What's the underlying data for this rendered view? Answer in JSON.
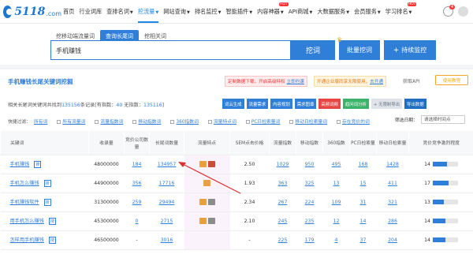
{
  "nav": {
    "logo_text": "5118",
    "logo_suffix": ".com",
    "items": [
      {
        "label": "首页",
        "active": false,
        "caret": false,
        "hot": ""
      },
      {
        "label": "行业词库",
        "active": false,
        "caret": false,
        "hot": ""
      },
      {
        "label": "查排名词",
        "active": false,
        "caret": true,
        "hot": ""
      },
      {
        "label": "挖流量",
        "active": true,
        "caret": true,
        "hot": ""
      },
      {
        "label": "网站查询",
        "active": false,
        "caret": true,
        "hot": ""
      },
      {
        "label": "排名监控",
        "active": false,
        "caret": true,
        "hot": ""
      },
      {
        "label": "智能插件",
        "active": false,
        "caret": true,
        "hot": ""
      },
      {
        "label": "内容神器",
        "active": false,
        "caret": true,
        "hot": "HOT"
      },
      {
        "label": "API商城",
        "active": false,
        "caret": true,
        "hot": ""
      },
      {
        "label": "大数据服务",
        "active": false,
        "caret": true,
        "hot": ""
      },
      {
        "label": "会员服务",
        "active": false,
        "caret": true,
        "hot": ""
      },
      {
        "label": "学习排名",
        "active": false,
        "caret": true,
        "hot": "HOT"
      }
    ],
    "notif_count": "4"
  },
  "search": {
    "tabs": [
      "挖移动端流量词",
      "查询长尾词",
      "挖相关词"
    ],
    "active_tab": 1,
    "value": "手机赚钱",
    "dig_label": "挖词",
    "batch_label": "批量挖词",
    "monitor_label": "持续监控"
  },
  "section": {
    "title_kw": "手机赚钱",
    "title_rest": "长尾关键词挖掘",
    "custom_note": "定制数据下载，开启高级特权",
    "custom_link": "立即约课",
    "open_note": "开通企业版同享无限使用，",
    "open_link": "去开通",
    "api_label": "获取API",
    "usage_label": "使用教程"
  },
  "summary": {
    "prefix": "相关长尾词关键词共找到",
    "total": "135156",
    "mid": "条记录[有指数：",
    "with_index": "40",
    "no_index_label": "无指数：",
    "no_index": "135116",
    "suffix": "]"
  },
  "toolbar": [
    {
      "label": "词云生成",
      "style": ""
    },
    {
      "label": "流量需求",
      "style": ""
    },
    {
      "label": "内容规划",
      "style": ""
    },
    {
      "label": "需求图谱",
      "style": ""
    },
    {
      "label": "高频词频",
      "style": "red"
    },
    {
      "label": "趋问词分析",
      "style": "green"
    },
    {
      "label": "+ 无限制导出",
      "style": "grey"
    },
    {
      "label": "导出数据",
      "style": "dark"
    }
  ],
  "filters": {
    "label": "快捷过滤：",
    "items": [
      "所有词",
      "所有流量词",
      "流量指数词",
      "移动指数词",
      "360指数词",
      "流量特点词",
      "PC日检索量词",
      "移动日检索量词",
      "存在竞价的词"
    ],
    "filter_label": "筛选日期：",
    "select_value": "请选择时间点"
  },
  "table": {
    "headers": [
      "关键词",
      "收录量",
      "竞价公司数量",
      "长尾词数量",
      "流量特点",
      "SEM点击价格",
      "流量指数",
      "移动指数",
      "360指数",
      "PC日检索量",
      "移动日检索量",
      "竞价竞争激烈程度"
    ],
    "rows": [
      {
        "kw": "手机赚钱",
        "shoulu": "48000000",
        "jingjia": "184",
        "changwei": "134957",
        "icons": [
          "img",
          "vid"
        ],
        "sem": "2.50",
        "liuliang": "1029",
        "yidong": "950",
        "s360": "495",
        "pc": "168",
        "ydr": "1428",
        "jz": "14",
        "jz_frac": 0.55
      },
      {
        "kw": "手机怎么赚钱",
        "shoulu": "44900000",
        "jingjia": "356",
        "changwei": "17716",
        "icons": [
          "img"
        ],
        "sem": "1.93",
        "liuliang": "363",
        "yidong": "325",
        "s360": "13",
        "pc": "15",
        "ydr": "411",
        "jz": "17",
        "jz_frac": 0.62
      },
      {
        "kw": "手机赚钱软件",
        "shoulu": "31300000",
        "jingjia": "259",
        "changwei": "29494",
        "icons": [
          "img",
          "kb"
        ],
        "sem": "2.34",
        "liuliang": "267",
        "yidong": "224",
        "s360": "109",
        "pc": "31",
        "ydr": "321",
        "jz": "13",
        "jz_frac": 0.45
      },
      {
        "kw": "用手机怎么赚钱",
        "shoulu": "45300000",
        "jingjia": "0",
        "changwei": "2715",
        "icons": [
          "img",
          "kb"
        ],
        "sem": "2.10",
        "liuliang": "245",
        "yidong": "235",
        "s360": "12",
        "pc": "14",
        "ydr": "286",
        "jz": "14",
        "jz_frac": 0.5
      },
      {
        "kw": "怎样用手机赚钱",
        "shoulu": "46500000",
        "jingjia": "-",
        "changwei": "3016",
        "icons": [],
        "sem": "-",
        "liuliang": "225",
        "yidong": "179",
        "s360": "4",
        "pc": "37",
        "ydr": "204",
        "jz": "14",
        "jz_frac": 0.5
      }
    ],
    "search_tag": "搜"
  }
}
